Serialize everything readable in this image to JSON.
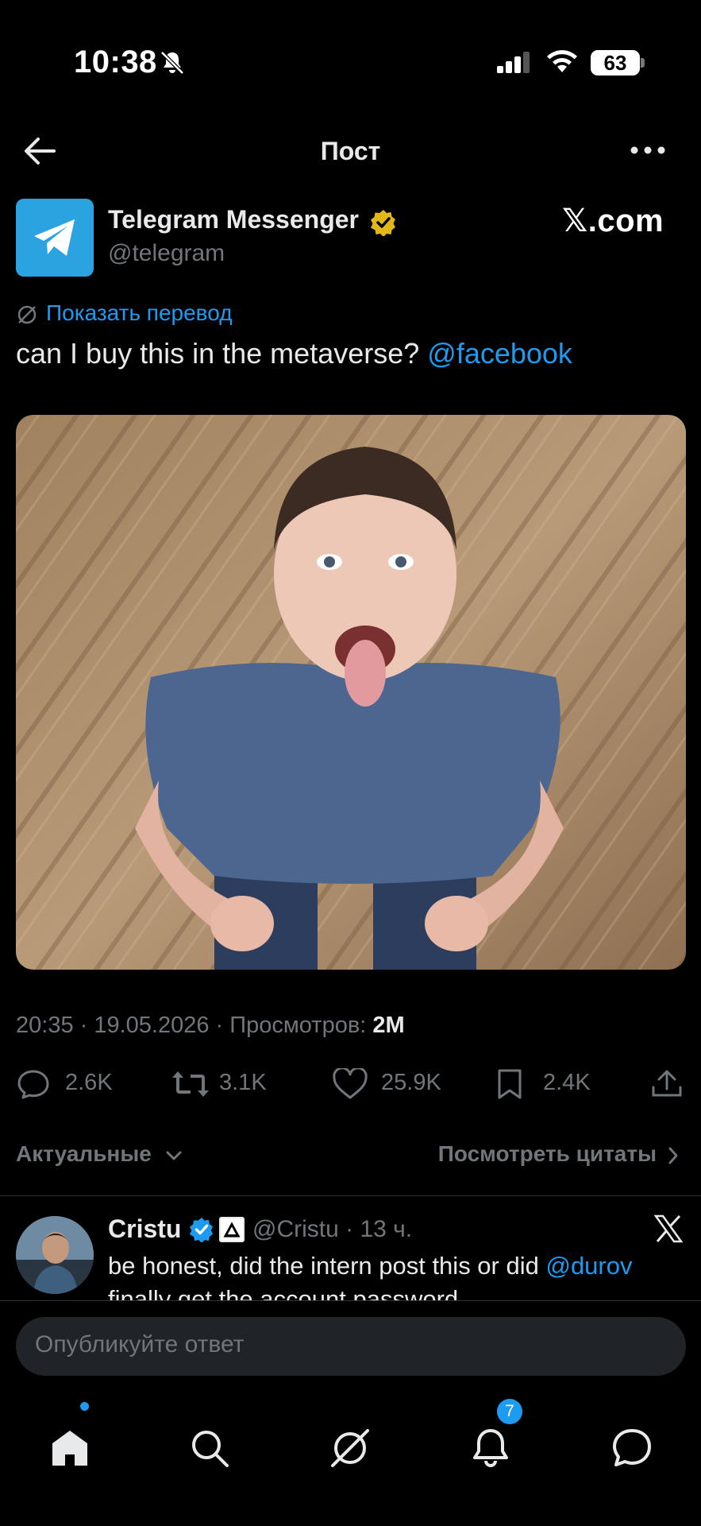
{
  "status": {
    "time": "10:38",
    "battery": "63"
  },
  "nav": {
    "title": "Пост"
  },
  "author": {
    "name": "Telegram Messenger",
    "handle": "@telegram",
    "site_logo": "𝕏.com"
  },
  "translate": {
    "label": "Показать перевод"
  },
  "post": {
    "text": "can I buy this in the metaverse? ",
    "mention": "@facebook"
  },
  "meta": {
    "prefix": "20:35 · 19.05.2026 · Просмотров: ",
    "views": "2M"
  },
  "actions": {
    "replies": "2.6K",
    "reposts": "3.1K",
    "likes": "25.9K",
    "bookmarks": "2.4K"
  },
  "filters": {
    "sort": "Актуальные",
    "quotes": "Посмотреть цитаты"
  },
  "reply": {
    "name": "Cristu",
    "handle_time": "@Cristu · 13 ч.",
    "text": "be honest, did the intern post this or did ",
    "mention": "@durov",
    "text_rest": " finally get the account password"
  },
  "compose": {
    "placeholder": "Опубликуйте ответ"
  },
  "tabs": {
    "notifications_badge": "7"
  },
  "icons": [
    "bell-off-icon",
    "signal-icon",
    "wifi-icon",
    "battery-icon",
    "back-arrow-icon",
    "more-icon",
    "telegram-logo-icon",
    "verified-gold-icon",
    "translate-icon",
    "reply-icon",
    "repost-icon",
    "like-icon",
    "bookmark-icon",
    "share-icon",
    "chevron-down-icon",
    "chevron-right-icon",
    "verified-blue-icon",
    "x-logo-icon",
    "home-icon",
    "search-icon",
    "grok-icon",
    "notifications-icon",
    "messages-icon"
  ],
  "colors": {
    "accent": "#1d9bf0",
    "background": "#000000",
    "muted": "#71767b",
    "verified_gold": "#e2b719"
  }
}
